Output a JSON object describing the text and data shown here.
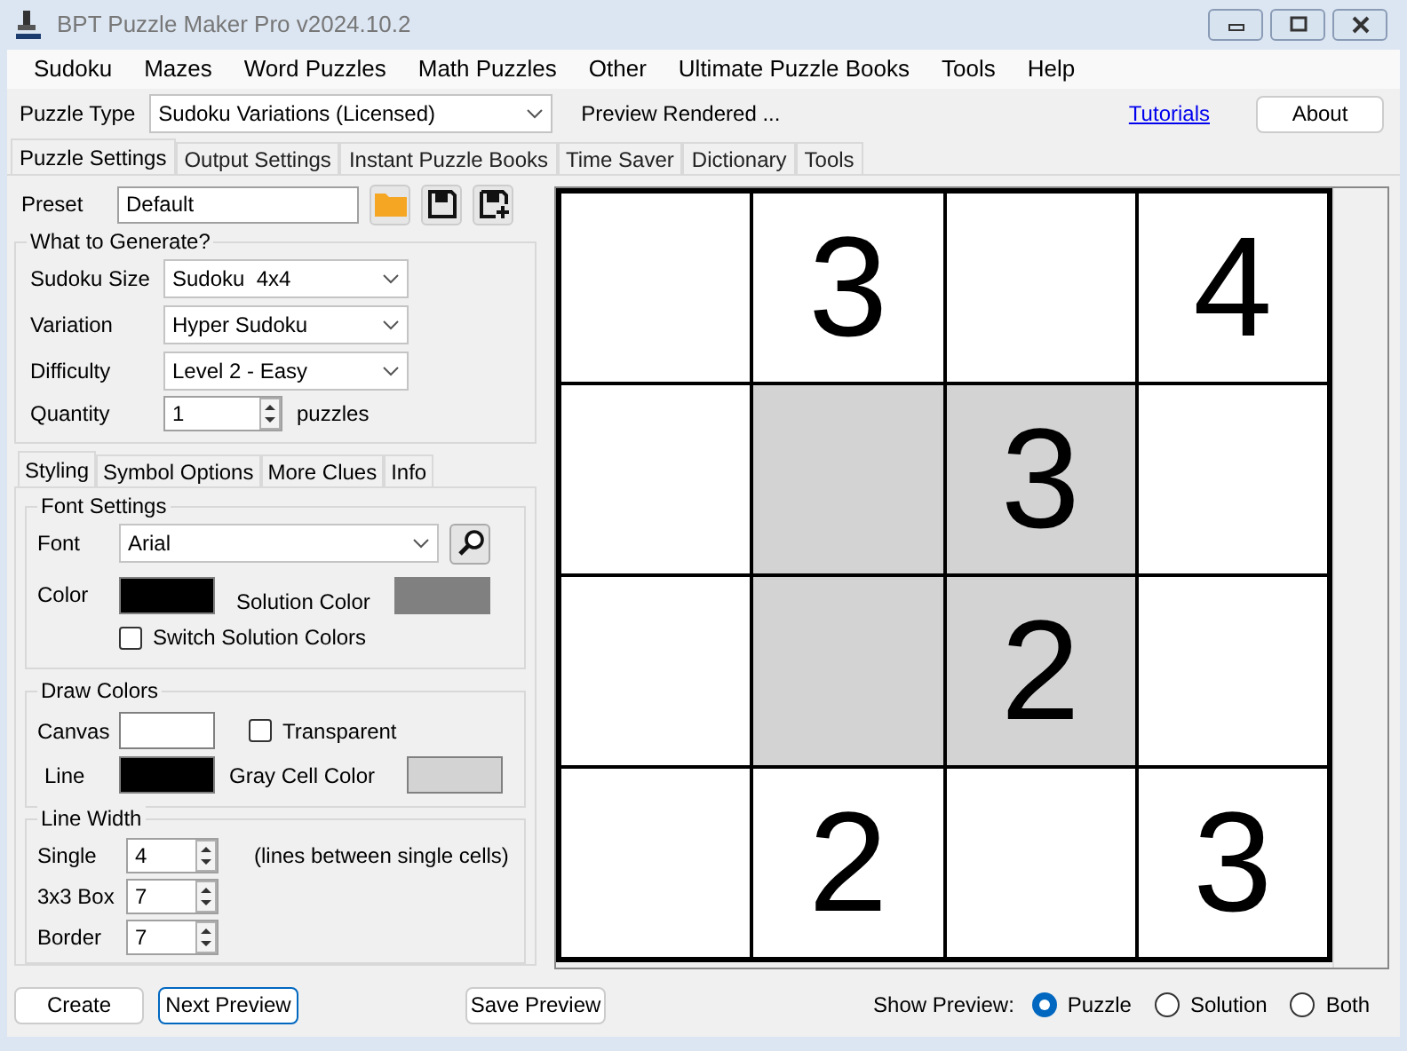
{
  "window": {
    "title": "BPT Puzzle Maker Pro v2024.10.2"
  },
  "menu": [
    "Sudoku",
    "Mazes",
    "Word Puzzles",
    "Math Puzzles",
    "Other",
    "Ultimate Puzzle Books",
    "Tools",
    "Help"
  ],
  "puzzle_type": {
    "label": "Puzzle Type",
    "value": "Sudoku Variations (Licensed)",
    "status": "Preview Rendered ...",
    "link": "Tutorials",
    "about": "About"
  },
  "tabs": [
    {
      "label": "Puzzle Settings",
      "selected": true
    },
    {
      "label": "Output Settings",
      "selected": false
    },
    {
      "label": "Instant Puzzle Books",
      "selected": false
    },
    {
      "label": "Time Saver",
      "selected": false
    },
    {
      "label": "Dictionary",
      "selected": false
    },
    {
      "label": "Tools",
      "selected": false
    }
  ],
  "preset": {
    "label": "Preset",
    "value": "Default"
  },
  "generate": {
    "title": "What to Generate?",
    "fields": [
      {
        "label": "Sudoku Size",
        "value": "Sudoku  4x4"
      },
      {
        "label": "Variation",
        "value": "Hyper Sudoku"
      },
      {
        "label": "Difficulty",
        "value": "Level 2 - Easy"
      }
    ],
    "quantity": {
      "label": "Quantity",
      "value": "1",
      "unit": "puzzles"
    }
  },
  "sub_tabs": [
    {
      "label": "Styling",
      "selected": true
    },
    {
      "label": "Symbol Options",
      "selected": false
    },
    {
      "label": "More Clues",
      "selected": false
    },
    {
      "label": "Info",
      "selected": false
    }
  ],
  "font_settings": {
    "title": "Font Settings",
    "font_label": "Font",
    "font": "Arial",
    "font_color": {
      "label": "Color",
      "color": "#000000"
    },
    "solution": {
      "label": "Solution Color",
      "color": "#808080"
    },
    "switch": {
      "label": "Switch Solution Colors",
      "checked": false
    }
  },
  "draw_colors": {
    "title": "Draw Colors",
    "canvas": {
      "label": "Canvas",
      "color": "#ffffff"
    },
    "transparent": {
      "label": "Transparent",
      "checked": false
    },
    "line": {
      "label": "Line",
      "color": "#000000"
    },
    "gray": {
      "label": "Gray Cell Color",
      "color": "#d3d3d3"
    }
  },
  "line_width": {
    "title": "Line Width",
    "rows": [
      {
        "label": "Single",
        "value": "4",
        "note": "(lines between single cells)"
      },
      {
        "label": "3x3 Box",
        "value": "7"
      },
      {
        "label": "Border",
        "value": "7"
      }
    ]
  },
  "grid": [
    [
      {
        "gray": false
      },
      {
        "value": "3",
        "gray": false
      },
      {
        "gray": false
      },
      {
        "value": "4",
        "gray": false
      }
    ],
    [
      {
        "gray": false
      },
      {
        "gray": true
      },
      {
        "value": "3",
        "gray": true
      },
      {
        "gray": false
      }
    ],
    [
      {
        "gray": false
      },
      {
        "gray": true
      },
      {
        "value": "2",
        "gray": true
      },
      {
        "gray": false
      }
    ],
    [
      {
        "gray": false
      },
      {
        "value": "2",
        "gray": false
      },
      {
        "gray": false
      },
      {
        "value": "3",
        "gray": false
      }
    ]
  ],
  "buttons": {
    "create": "Create",
    "next": "Next Preview",
    "save": "Save Preview"
  },
  "show_preview": {
    "label": "Show Preview:",
    "options": [
      {
        "label": "Puzzle",
        "selected": true
      },
      {
        "label": "Solution",
        "selected": false
      },
      {
        "label": "Both",
        "selected": false
      }
    ]
  }
}
